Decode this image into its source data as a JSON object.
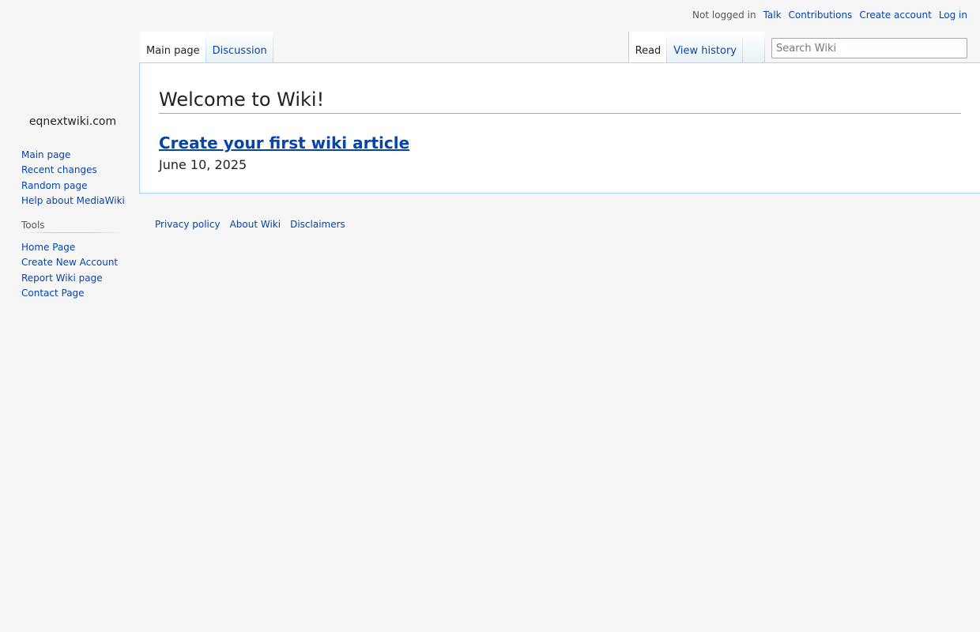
{
  "personal_tools": {
    "status": "Not logged in",
    "links": [
      "Talk",
      "Contributions",
      "Create account",
      "Log in"
    ]
  },
  "site": {
    "name": "eqnextwiki.com"
  },
  "navigation": {
    "items": [
      "Main page",
      "Recent changes",
      "Random page",
      "Help about MediaWiki"
    ]
  },
  "tools": {
    "heading": "Tools",
    "items": [
      "Home Page",
      "Create New Account",
      "Report Wiki page",
      "Contact Page"
    ]
  },
  "tabs": {
    "namespaces": [
      {
        "label": "Main page",
        "selected": true
      },
      {
        "label": "Discussion",
        "selected": false
      }
    ],
    "views": [
      {
        "label": "Read",
        "selected": true
      },
      {
        "label": "View history",
        "selected": false
      }
    ]
  },
  "search": {
    "placeholder": "Search Wiki"
  },
  "page": {
    "title": "Welcome to Wiki!",
    "article_link": "Create your first wiki article",
    "date": "June 10, 2025"
  },
  "footer": {
    "links": [
      "Privacy policy",
      "About Wiki",
      "Disclaimers"
    ]
  },
  "colors": {
    "link": "#0645ad",
    "background": "#f6f6f6",
    "tab_border": "#a7d7f9"
  }
}
